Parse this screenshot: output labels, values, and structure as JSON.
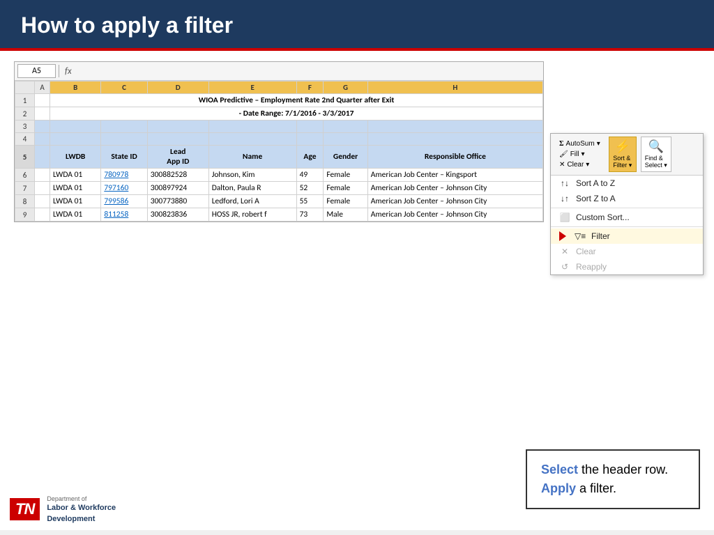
{
  "header": {
    "title": "How to apply a filter",
    "accent_color": "#cc0000",
    "bg_color": "#1e3a5f"
  },
  "formula_bar": {
    "cell_ref": "A5",
    "fx_label": "fx"
  },
  "spreadsheet": {
    "columns": [
      "A",
      "B",
      "C",
      "D",
      "E",
      "F",
      "G",
      "H"
    ],
    "title_row1": "WIOA Predictive – Employment Rate 2nd Quarter after Exit",
    "title_row2": "- Date Range: 7/1/2016 - 3/3/2017",
    "header_row": {
      "lwdb": "LWDB",
      "state_id": "State ID",
      "lead_app_id": "Lead App ID",
      "name": "Name",
      "age": "Age",
      "gender": "Gender",
      "responsible_office": "Responsible Office"
    },
    "data_rows": [
      {
        "row": "6",
        "lwdb": "LWDA 01",
        "state_id": "780978",
        "lead_app_id": "300882528",
        "name": "Johnson, Kim",
        "age": "49",
        "gender": "Female",
        "office": "American Job Center – Kingsport"
      },
      {
        "row": "7",
        "lwdb": "LWDA 01",
        "state_id": "797160",
        "lead_app_id": "300897924",
        "name": "Dalton, Paula R",
        "age": "52",
        "gender": "Female",
        "office": "American Job Center – Johnson City"
      },
      {
        "row": "8",
        "lwdb": "LWDA 01",
        "state_id": "799586",
        "lead_app_id": "300773880",
        "name": "Ledford, Lori A",
        "age": "55",
        "gender": "Female",
        "office": "American Job Center – Johnson City"
      },
      {
        "row": "9",
        "lwdb": "LWDA 01",
        "state_id": "811258",
        "lead_app_id": "300823836",
        "name": "HOSS JR, robert f",
        "age": "73",
        "gender": "Male",
        "office": "American Job Center – Johnson City"
      }
    ]
  },
  "ribbon": {
    "autosum_label": "AutoSum",
    "fill_label": "Fill",
    "clear_label": "Clear",
    "sort_filter_label": "Sort &\nFilter",
    "find_select_label": "Find &\nSelect",
    "menu_items": [
      {
        "id": "sort_a_z",
        "label": "Sort A to Z",
        "icon": "↑↓",
        "disabled": false
      },
      {
        "id": "sort_z_a",
        "label": "Sort Z to A",
        "icon": "↓↑",
        "disabled": false
      },
      {
        "id": "custom_sort",
        "label": "Custom Sort...",
        "icon": "≡",
        "disabled": false
      },
      {
        "id": "filter",
        "label": "Filter",
        "icon": "▽",
        "disabled": false,
        "highlighted": true
      },
      {
        "id": "clear",
        "label": "Clear",
        "icon": "✕",
        "disabled": true
      },
      {
        "id": "reapply",
        "label": "Reapply",
        "icon": "↺",
        "disabled": true
      }
    ]
  },
  "instruction_box": {
    "select_text": "Select",
    "middle_text": " the header row.",
    "apply_text": "Apply",
    "end_text": " a filter."
  },
  "footer": {
    "dept_label": "Department of",
    "org_line1": "Labor & Workforce",
    "org_line2": "Development"
  }
}
